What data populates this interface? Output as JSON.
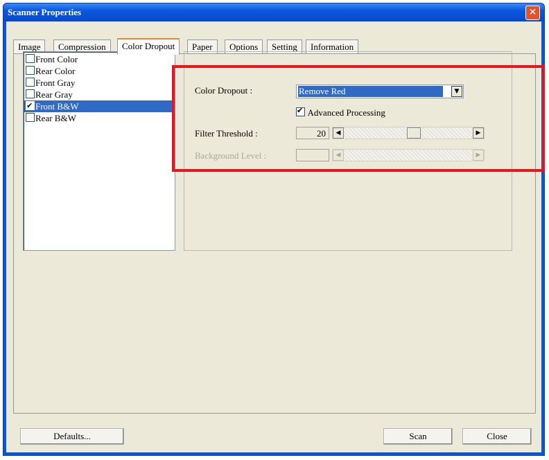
{
  "window": {
    "title": "Scanner Properties",
    "close_symbol": "✕"
  },
  "tabs": [
    {
      "label": "Image"
    },
    {
      "label": "Compression"
    },
    {
      "label": "Color Dropout"
    },
    {
      "label": "Paper"
    },
    {
      "label": "Options"
    },
    {
      "label": "Setting"
    },
    {
      "label": "Information"
    }
  ],
  "active_tab": "Color Dropout",
  "image_list": [
    {
      "label": "Front Color",
      "checked": false
    },
    {
      "label": "Rear Color",
      "checked": false
    },
    {
      "label": "Front Gray",
      "checked": false
    },
    {
      "label": "Rear Gray",
      "checked": false
    },
    {
      "label": "Front B&W",
      "checked": true
    },
    {
      "label": "Rear B&W",
      "checked": false
    }
  ],
  "selected_image": "Front B&W",
  "settings": {
    "color_dropout_label": "Color Dropout :",
    "color_dropout_value": "Remove Red",
    "advanced_processing_label": "Advanced Processing",
    "advanced_processing_checked": true,
    "filter_threshold_label": "Filter Threshold :",
    "filter_threshold_value": "20",
    "background_level_label": "Background Level :"
  },
  "buttons": {
    "defaults": "Defaults...",
    "scan": "Scan",
    "close": "Close"
  },
  "colors": {
    "titlebar": "#0a57e0",
    "selection": "#316ac5",
    "highlight_frame": "#e8151c",
    "dialog_bg": "#ece9d8"
  }
}
